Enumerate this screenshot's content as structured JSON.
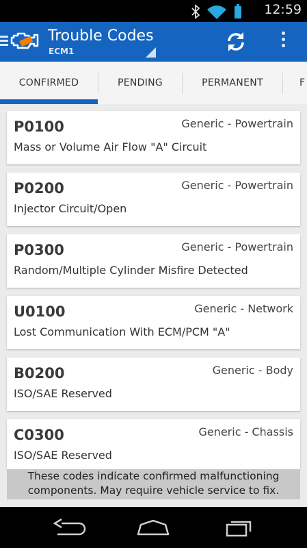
{
  "status_bar": {
    "time": "12:59"
  },
  "action_bar": {
    "title": "Trouble Codes",
    "subtitle": "ECM1"
  },
  "tabs": [
    {
      "label": "CONFIRMED",
      "selected": true
    },
    {
      "label": "PENDING",
      "selected": false
    },
    {
      "label": "PERMANENT",
      "selected": false
    },
    {
      "label": "F",
      "selected": false
    }
  ],
  "codes": [
    {
      "code": "P0100",
      "category": "Generic - Powertrain",
      "description": "Mass or Volume Air Flow \"A\" Circuit"
    },
    {
      "code": "P0200",
      "category": "Generic - Powertrain",
      "description": "Injector Circuit/Open"
    },
    {
      "code": "P0300",
      "category": "Generic - Powertrain",
      "description": "Random/Multiple Cylinder Misfire Detected"
    },
    {
      "code": "U0100",
      "category": "Generic - Network",
      "description": "Lost Communication With ECM/PCM \"A\""
    },
    {
      "code": "B0200",
      "category": "Generic - Body",
      "description": "ISO/SAE Reserved"
    },
    {
      "code": "C0300",
      "category": "Generic - Chassis",
      "description": "ISO/SAE Reserved"
    }
  ],
  "notice": {
    "line1": "These codes indicate confirmed malfunctioning",
    "line2": "components. May require vehicle service to fix."
  },
  "colors": {
    "accent": "#1565c0",
    "background": "#ebebeb"
  },
  "icons": [
    "bluetooth-icon",
    "wifi-icon",
    "battery-icon",
    "menu-icon",
    "check-engine-icon",
    "refresh-icon",
    "overflow-menu-icon",
    "back-icon",
    "home-icon",
    "recent-apps-icon"
  ]
}
